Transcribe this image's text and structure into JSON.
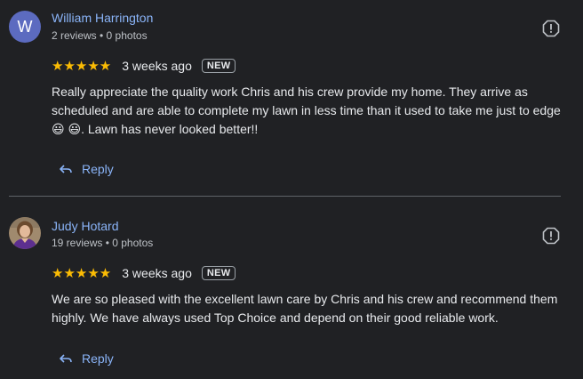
{
  "reviews": [
    {
      "avatar_letter": "W",
      "name": "William Harrington",
      "meta": "2 reviews • 0 photos",
      "stars": "★★★★★",
      "rating": 5,
      "date": "3 weeks ago",
      "badge": "NEW",
      "text": "Really appreciate the quality work Chris and his crew provide my home. They arrive as scheduled and are able to complete my lawn in less time than it used to take me just to edge 😃 😃. Lawn has never looked better!!",
      "reply_label": "Reply"
    },
    {
      "avatar_letter": "",
      "name": "Judy Hotard",
      "meta": "19 reviews • 0 photos",
      "stars": "★★★★★",
      "rating": 5,
      "date": "3 weeks ago",
      "badge": "NEW",
      "text": "We are so pleased with the excellent lawn care by Chris and his crew and recommend them highly. We have always used Top Choice and depend on their good reliable work.",
      "reply_label": "Reply"
    }
  ],
  "icons": {
    "flag": "report-flag-icon",
    "reply": "reply-arrow-icon",
    "star": "star-icon"
  },
  "colors": {
    "background": "#202124",
    "link": "#8ab4f8",
    "star": "#fbbc04",
    "avatar_w": "#5c6bc0"
  }
}
